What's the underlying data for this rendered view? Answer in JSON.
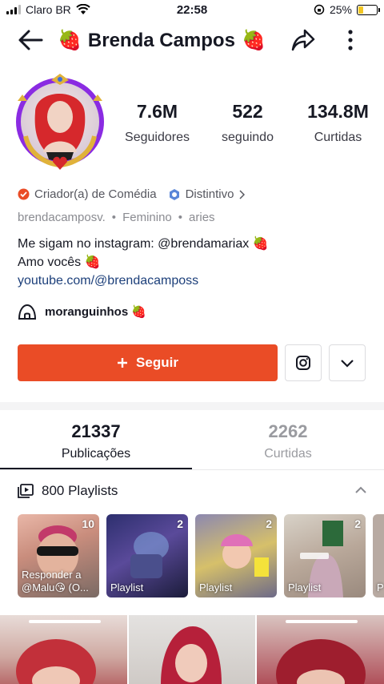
{
  "status_bar": {
    "carrier": "Claro BR",
    "time": "22:58",
    "battery": "25%"
  },
  "header": {
    "title": "Brenda Campos",
    "title_emoji": "🍓"
  },
  "profile": {
    "stats": [
      {
        "value": "7.6M",
        "label": "Seguidores"
      },
      {
        "value": "522",
        "label": "seguindo"
      },
      {
        "value": "134.8M",
        "label": "Curtidas"
      }
    ],
    "category": "Criador(a) de Comédia",
    "badge": "Distintivo",
    "username": "brendacamposv.",
    "gender": "Feminino",
    "sign": "aries",
    "bio_line1": "Me sigam no instagram: @brendamariax 🍓",
    "bio_line2": "Amo vocês 🍓",
    "bio_link": "youtube.com/@brendacamposs",
    "group_name": "moranguinhos 🍓"
  },
  "actions": {
    "follow_label": "Seguir"
  },
  "tabs": [
    {
      "value": "21337",
      "label": "Publicações"
    },
    {
      "value": "2262",
      "label": "Curtidas"
    }
  ],
  "playlists": {
    "title": "800 Playlists",
    "cards": [
      {
        "count": "10",
        "caption": "Responder a @Malu😘 (O..."
      },
      {
        "count": "2",
        "caption": "Playlist"
      },
      {
        "count": "2",
        "caption": "Playlist"
      },
      {
        "count": "2",
        "caption": "Playlist"
      },
      {
        "count": "",
        "caption": "P"
      }
    ]
  },
  "colors": {
    "accent": "#ea4c26",
    "link": "#1c3f7a"
  }
}
